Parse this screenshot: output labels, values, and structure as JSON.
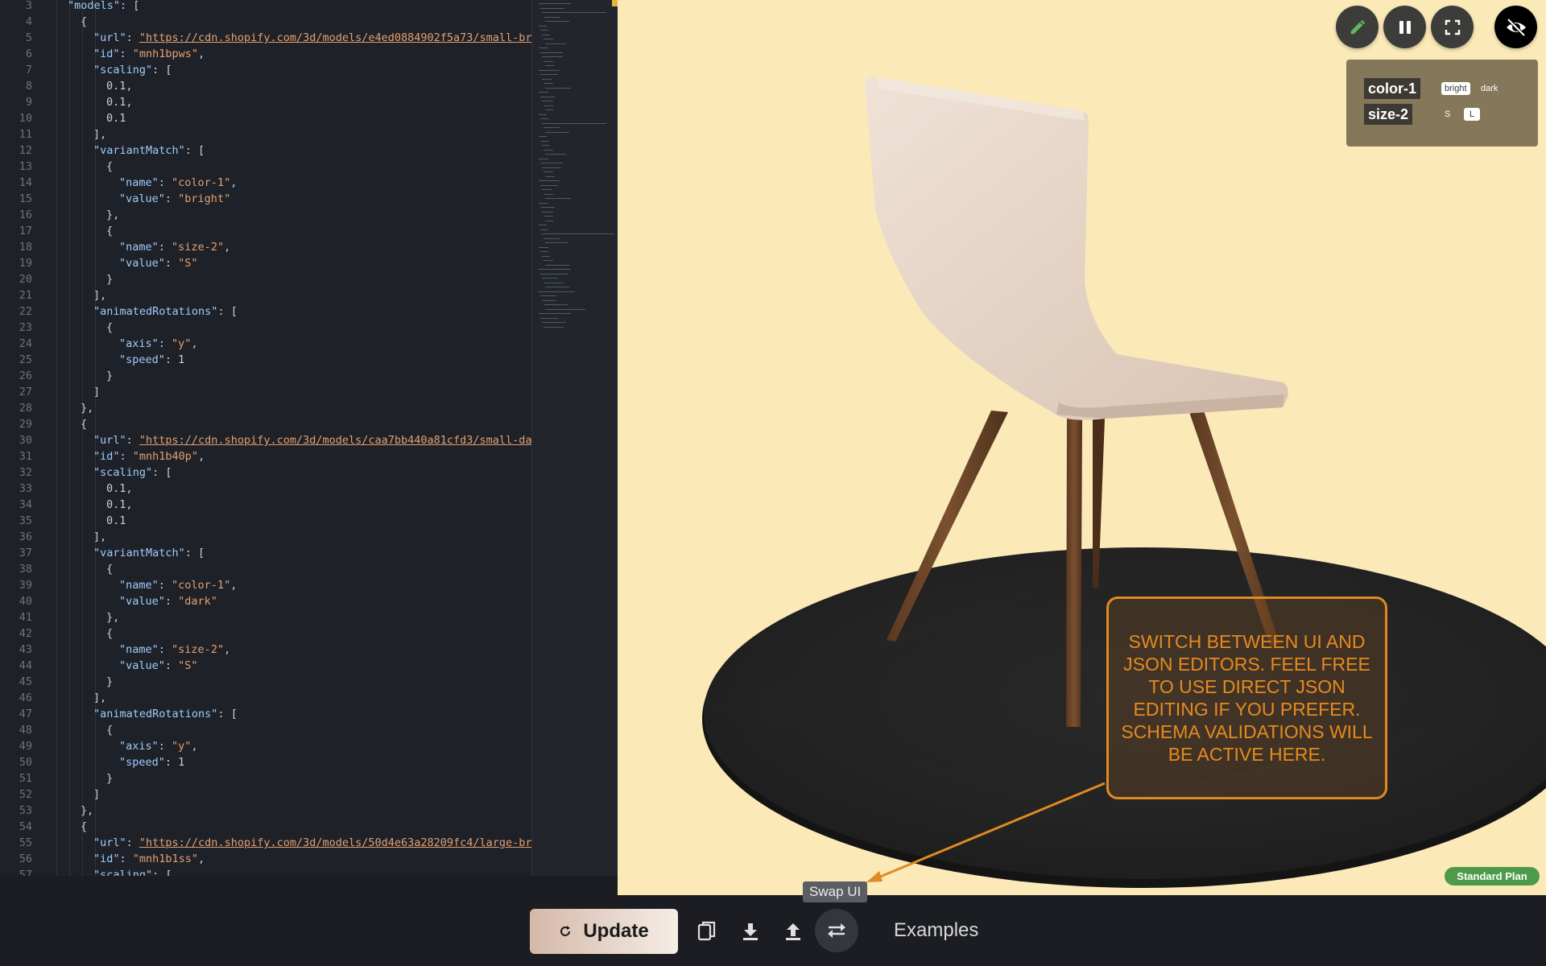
{
  "editor": {
    "lines": [
      {
        "n": "3",
        "indent": 1,
        "tokens": [
          [
            "key",
            "\"models\""
          ],
          [
            "p",
            ": ["
          ]
        ]
      },
      {
        "n": "4",
        "indent": 2,
        "tokens": [
          [
            "p",
            "{"
          ]
        ]
      },
      {
        "n": "5",
        "indent": 3,
        "tokens": [
          [
            "key",
            "\"url\""
          ],
          [
            "p",
            ": "
          ],
          [
            "url",
            "\"https://cdn.shopify.com/3d/models/e4ed0884902f5a73/small-bri"
          ]
        ]
      },
      {
        "n": "6",
        "indent": 3,
        "tokens": [
          [
            "key",
            "\"id\""
          ],
          [
            "p",
            ": "
          ],
          [
            "str",
            "\"mnh1bpws\""
          ],
          [
            "p",
            ","
          ]
        ]
      },
      {
        "n": "7",
        "indent": 3,
        "tokens": [
          [
            "key",
            "\"scaling\""
          ],
          [
            "p",
            ": ["
          ]
        ]
      },
      {
        "n": "8",
        "indent": 4,
        "tokens": [
          [
            "num",
            "0.1,"
          ]
        ]
      },
      {
        "n": "9",
        "indent": 4,
        "tokens": [
          [
            "num",
            "0.1,"
          ]
        ]
      },
      {
        "n": "10",
        "indent": 4,
        "tokens": [
          [
            "num",
            "0.1"
          ]
        ]
      },
      {
        "n": "11",
        "indent": 3,
        "tokens": [
          [
            "p",
            "],"
          ]
        ]
      },
      {
        "n": "12",
        "indent": 3,
        "tokens": [
          [
            "key",
            "\"variantMatch\""
          ],
          [
            "p",
            ": ["
          ]
        ]
      },
      {
        "n": "13",
        "indent": 4,
        "tokens": [
          [
            "p",
            "{"
          ]
        ]
      },
      {
        "n": "14",
        "indent": 5,
        "tokens": [
          [
            "key",
            "\"name\""
          ],
          [
            "p",
            ": "
          ],
          [
            "str",
            "\"color-1\""
          ],
          [
            "p",
            ","
          ]
        ]
      },
      {
        "n": "15",
        "indent": 5,
        "tokens": [
          [
            "key",
            "\"value\""
          ],
          [
            "p",
            ": "
          ],
          [
            "str",
            "\"bright\""
          ]
        ]
      },
      {
        "n": "16",
        "indent": 4,
        "tokens": [
          [
            "p",
            "},"
          ]
        ]
      },
      {
        "n": "17",
        "indent": 4,
        "tokens": [
          [
            "p",
            "{"
          ]
        ]
      },
      {
        "n": "18",
        "indent": 5,
        "tokens": [
          [
            "key",
            "\"name\""
          ],
          [
            "p",
            ": "
          ],
          [
            "str",
            "\"size-2\""
          ],
          [
            "p",
            ","
          ]
        ]
      },
      {
        "n": "19",
        "indent": 5,
        "tokens": [
          [
            "key",
            "\"value\""
          ],
          [
            "p",
            ": "
          ],
          [
            "str",
            "\"S\""
          ]
        ]
      },
      {
        "n": "20",
        "indent": 4,
        "tokens": [
          [
            "p",
            "}"
          ]
        ]
      },
      {
        "n": "21",
        "indent": 3,
        "tokens": [
          [
            "p",
            "],"
          ]
        ]
      },
      {
        "n": "22",
        "indent": 3,
        "tokens": [
          [
            "key",
            "\"animatedRotations\""
          ],
          [
            "p",
            ": ["
          ]
        ]
      },
      {
        "n": "23",
        "indent": 4,
        "tokens": [
          [
            "p",
            "{"
          ]
        ]
      },
      {
        "n": "24",
        "indent": 5,
        "tokens": [
          [
            "key",
            "\"axis\""
          ],
          [
            "p",
            ": "
          ],
          [
            "str",
            "\"y\""
          ],
          [
            "p",
            ","
          ]
        ]
      },
      {
        "n": "25",
        "indent": 5,
        "tokens": [
          [
            "key",
            "\"speed\""
          ],
          [
            "p",
            ": "
          ],
          [
            "num",
            "1"
          ]
        ]
      },
      {
        "n": "26",
        "indent": 4,
        "tokens": [
          [
            "p",
            "}"
          ]
        ]
      },
      {
        "n": "27",
        "indent": 3,
        "tokens": [
          [
            "p",
            "]"
          ]
        ]
      },
      {
        "n": "28",
        "indent": 2,
        "tokens": [
          [
            "p",
            "},"
          ]
        ]
      },
      {
        "n": "29",
        "indent": 2,
        "tokens": [
          [
            "p",
            "{"
          ]
        ]
      },
      {
        "n": "30",
        "indent": 3,
        "tokens": [
          [
            "key",
            "\"url\""
          ],
          [
            "p",
            ": "
          ],
          [
            "url",
            "\"https://cdn.shopify.com/3d/models/caa7bb440a81cfd3/small-dar"
          ]
        ]
      },
      {
        "n": "31",
        "indent": 3,
        "tokens": [
          [
            "key",
            "\"id\""
          ],
          [
            "p",
            ": "
          ],
          [
            "str",
            "\"mnh1b40p\""
          ],
          [
            "p",
            ","
          ]
        ]
      },
      {
        "n": "32",
        "indent": 3,
        "tokens": [
          [
            "key",
            "\"scaling\""
          ],
          [
            "p",
            ": ["
          ]
        ]
      },
      {
        "n": "33",
        "indent": 4,
        "tokens": [
          [
            "num",
            "0.1,"
          ]
        ]
      },
      {
        "n": "34",
        "indent": 4,
        "tokens": [
          [
            "num",
            "0.1,"
          ]
        ]
      },
      {
        "n": "35",
        "indent": 4,
        "tokens": [
          [
            "num",
            "0.1"
          ]
        ]
      },
      {
        "n": "36",
        "indent": 3,
        "tokens": [
          [
            "p",
            "],"
          ]
        ]
      },
      {
        "n": "37",
        "indent": 3,
        "tokens": [
          [
            "key",
            "\"variantMatch\""
          ],
          [
            "p",
            ": ["
          ]
        ]
      },
      {
        "n": "38",
        "indent": 4,
        "tokens": [
          [
            "p",
            "{"
          ]
        ]
      },
      {
        "n": "39",
        "indent": 5,
        "tokens": [
          [
            "key",
            "\"name\""
          ],
          [
            "p",
            ": "
          ],
          [
            "str",
            "\"color-1\""
          ],
          [
            "p",
            ","
          ]
        ]
      },
      {
        "n": "40",
        "indent": 5,
        "tokens": [
          [
            "key",
            "\"value\""
          ],
          [
            "p",
            ": "
          ],
          [
            "str",
            "\"dark\""
          ]
        ]
      },
      {
        "n": "41",
        "indent": 4,
        "tokens": [
          [
            "p",
            "},"
          ]
        ]
      },
      {
        "n": "42",
        "indent": 4,
        "tokens": [
          [
            "p",
            "{"
          ]
        ]
      },
      {
        "n": "43",
        "indent": 5,
        "tokens": [
          [
            "key",
            "\"name\""
          ],
          [
            "p",
            ": "
          ],
          [
            "str",
            "\"size-2\""
          ],
          [
            "p",
            ","
          ]
        ]
      },
      {
        "n": "44",
        "indent": 5,
        "tokens": [
          [
            "key",
            "\"value\""
          ],
          [
            "p",
            ": "
          ],
          [
            "str",
            "\"S\""
          ]
        ]
      },
      {
        "n": "45",
        "indent": 4,
        "tokens": [
          [
            "p",
            "}"
          ]
        ]
      },
      {
        "n": "46",
        "indent": 3,
        "tokens": [
          [
            "p",
            "],"
          ]
        ]
      },
      {
        "n": "47",
        "indent": 3,
        "tokens": [
          [
            "key",
            "\"animatedRotations\""
          ],
          [
            "p",
            ": ["
          ]
        ]
      },
      {
        "n": "48",
        "indent": 4,
        "tokens": [
          [
            "p",
            "{"
          ]
        ]
      },
      {
        "n": "49",
        "indent": 5,
        "tokens": [
          [
            "key",
            "\"axis\""
          ],
          [
            "p",
            ": "
          ],
          [
            "str",
            "\"y\""
          ],
          [
            "p",
            ","
          ]
        ]
      },
      {
        "n": "50",
        "indent": 5,
        "tokens": [
          [
            "key",
            "\"speed\""
          ],
          [
            "p",
            ": "
          ],
          [
            "num",
            "1"
          ]
        ]
      },
      {
        "n": "51",
        "indent": 4,
        "tokens": [
          [
            "p",
            "}"
          ]
        ]
      },
      {
        "n": "52",
        "indent": 3,
        "tokens": [
          [
            "p",
            "]"
          ]
        ]
      },
      {
        "n": "53",
        "indent": 2,
        "tokens": [
          [
            "p",
            "},"
          ]
        ]
      },
      {
        "n": "54",
        "indent": 2,
        "tokens": [
          [
            "p",
            "{"
          ]
        ]
      },
      {
        "n": "55",
        "indent": 3,
        "tokens": [
          [
            "key",
            "\"url\""
          ],
          [
            "p",
            ": "
          ],
          [
            "url",
            "\"https://cdn.shopify.com/3d/models/50d4e63a28209fc4/large-bri"
          ]
        ]
      },
      {
        "n": "56",
        "indent": 3,
        "tokens": [
          [
            "key",
            "\"id\""
          ],
          [
            "p",
            ": "
          ],
          [
            "str",
            "\"mnh1b1ss\""
          ],
          [
            "p",
            ","
          ]
        ]
      },
      {
        "n": "57",
        "indent": 3,
        "tokens": [
          [
            "key",
            "\"scaling\""
          ],
          [
            "p",
            ": ["
          ]
        ]
      }
    ]
  },
  "viewer": {
    "controls": [
      {
        "name": "edit-icon",
        "glyph": "pencil",
        "color": "#5cb85c"
      },
      {
        "name": "pause-icon",
        "glyph": "pause",
        "color": "#ffffff"
      },
      {
        "name": "fullscreen-icon",
        "glyph": "fullscreen",
        "color": "#ffffff"
      },
      {
        "name": "hide-icon",
        "glyph": "eye-off",
        "color": "#ffffff"
      }
    ],
    "variants": [
      {
        "name": "color-1",
        "options": [
          {
            "label": "bright",
            "selected": true
          },
          {
            "label": "dark",
            "selected": false
          }
        ]
      },
      {
        "name": "size-2",
        "options": [
          {
            "label": "S",
            "selected": false
          },
          {
            "label": "L",
            "selected": true
          }
        ]
      }
    ],
    "callout": "SWITCH BETWEEN UI AND JSON EDITORS. FEEL FREE TO USE DIRECT JSON EDITING IF YOU PREFER. SCHEMA VALIDATIONS WILL BE ACTIVE HERE.",
    "plan_badge": "Standard Plan",
    "colors": {
      "background": "#fbe9b8",
      "callout": "#e08a22",
      "rug": "#2a2a2a",
      "seat": "#e4d2c4",
      "legs": "#6d4526"
    }
  },
  "toolbar": {
    "update_label": "Update",
    "update_icon": "refresh-icon",
    "icons": [
      "copy-icon",
      "download-icon",
      "upload-icon",
      "swap-icon"
    ],
    "swap_tooltip": "Swap UI",
    "examples_label": "Examples"
  }
}
